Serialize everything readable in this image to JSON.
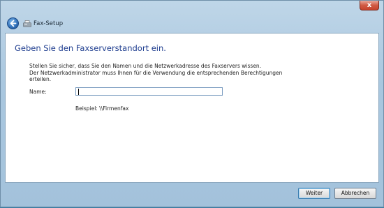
{
  "window": {
    "title": "Fax-Setup",
    "close_glyph": "x"
  },
  "page": {
    "heading": "Geben Sie den Faxserverstandort ein.",
    "description": [
      "Stellen Sie sicher, dass Sie den Namen und die Netzwerkadresse des Faxservers wissen.",
      "Der Netzwerkadministrator muss Ihnen für die Verwendung die entsprechenden Berechtigungen",
      "erteilen."
    ],
    "name_label": "Name:",
    "name_value": "",
    "example": "Beispiel: \\\\Firmenfax"
  },
  "footer": {
    "next_label": "Weiter",
    "cancel_label": "Abbrechen"
  },
  "icons": {
    "back": "back-arrow-icon",
    "fax": "fax-icon",
    "close": "close-icon"
  }
}
